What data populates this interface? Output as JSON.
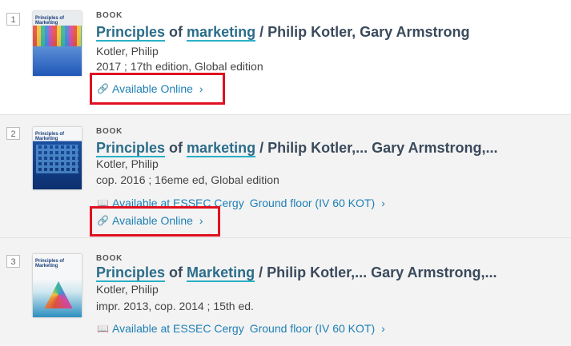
{
  "results": [
    {
      "number": "1",
      "type": "BOOK",
      "title_kw1": "Principles",
      "title_of": " of ",
      "title_kw2": "marketing",
      "title_rest": " / Philip Kotler, Gary Armstrong",
      "author": "Kotler, Philip",
      "edition": "2017 ; 17th edition, Global edition",
      "online": "Available Online",
      "cover_title": "Principles of Marketing"
    },
    {
      "number": "2",
      "type": "BOOK",
      "title_kw1": "Principles",
      "title_of": " of ",
      "title_kw2": "marketing",
      "title_rest": " / Philip Kotler,... Gary Armstrong,...",
      "author": "Kotler, Philip",
      "edition": "cop. 2016 ; 16eme ed, Global edition",
      "physical": "Available at ESSEC Cergy",
      "location": "Ground floor (IV 60 KOT)",
      "online": "Available Online",
      "cover_title": "Principles of Marketing"
    },
    {
      "number": "3",
      "type": "BOOK",
      "title_kw1": "Principles",
      "title_of": " of ",
      "title_kw2": "Marketing",
      "title_rest": " / Philip Kotler,... Gary Armstrong,...",
      "author": "Kotler, Philip",
      "edition": "impr. 2013, cop. 2014 ; 15th ed.",
      "physical": "Available at ESSEC Cergy",
      "location": "Ground floor (IV 60 KOT)",
      "cover_title": "Principles of Marketing"
    }
  ],
  "colors": {
    "link": "#1d7fb5",
    "highlight_box": "#e01020",
    "keyword_underline": "#2ab0c5"
  },
  "icons": {
    "online": "link-icon",
    "physical": "book-icon",
    "more": "chevron-right-icon"
  }
}
